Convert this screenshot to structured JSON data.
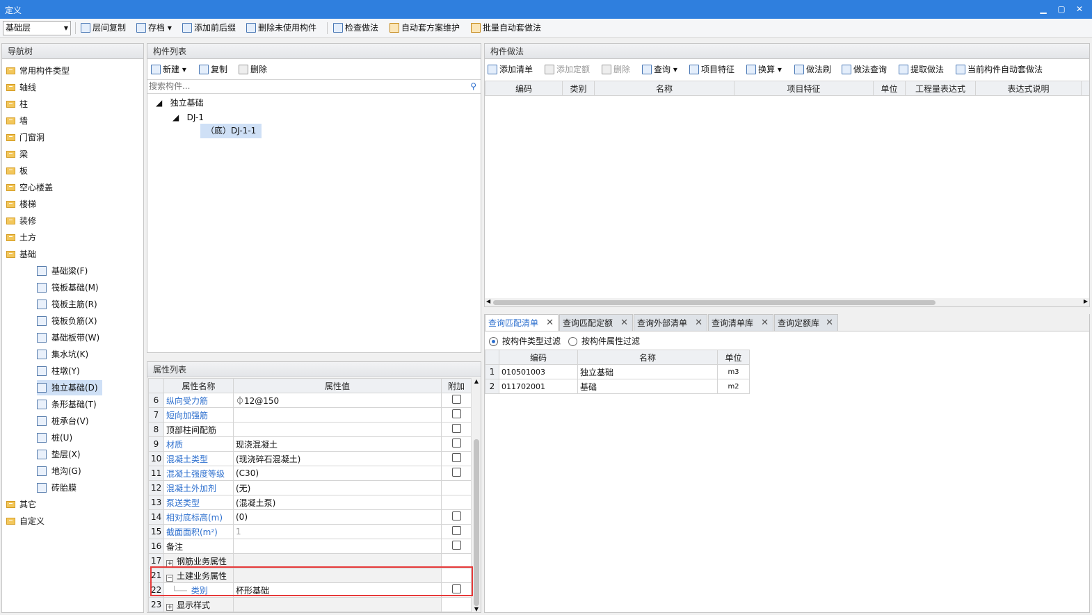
{
  "window": {
    "title": "定义"
  },
  "toolbar": {
    "floor_select": "基础层",
    "buttons": [
      "层间复制",
      "存档",
      "添加前后缀",
      "删除未使用构件",
      "检查做法",
      "自动套方案维护",
      "批量自动套做法"
    ]
  },
  "nav": {
    "title": "导航树",
    "top_items": [
      "常用构件类型",
      "轴线",
      "柱",
      "墙",
      "门窗洞",
      "梁",
      "板",
      "空心楼盖",
      "楼梯",
      "装修",
      "土方",
      "基础"
    ],
    "foundation_children": [
      "基础梁(F)",
      "筏板基础(M)",
      "筏板主筋(R)",
      "筏板负筋(X)",
      "基础板带(W)",
      "集水坑(K)",
      "柱墩(Y)",
      "独立基础(D)",
      "条形基础(T)",
      "桩承台(V)",
      "桩(U)",
      "垫层(X)",
      "地沟(G)",
      "砖胎膜"
    ],
    "bottom_items": [
      "其它",
      "自定义"
    ]
  },
  "component_list": {
    "title": "构件列表",
    "actions": [
      "新建",
      "复制",
      "删除"
    ],
    "search_placeholder": "搜索构件...",
    "tree": {
      "root": "独立基础",
      "child": "DJ-1",
      "leaf": "（底）DJ-1-1"
    }
  },
  "props": {
    "title": "属性列表",
    "headers": {
      "name": "属性名称",
      "value": "属性值",
      "extra": "附加"
    },
    "rows": [
      {
        "n": "6",
        "name": "纵向受力筋",
        "value": "⏀12@150",
        "link": true,
        "chk": true
      },
      {
        "n": "7",
        "name": "短向加强筋",
        "value": "",
        "link": true,
        "chk": true
      },
      {
        "n": "8",
        "name": "顶部柱间配筋",
        "value": "",
        "link": false,
        "chk": true
      },
      {
        "n": "9",
        "name": "材质",
        "value": "现浇混凝土",
        "link": true,
        "chk": true
      },
      {
        "n": "10",
        "name": "混凝土类型",
        "value": "(现浇碎石混凝土)",
        "link": true,
        "chk": true
      },
      {
        "n": "11",
        "name": "混凝土强度等级",
        "value": "(C30)",
        "link": true,
        "chk": true
      },
      {
        "n": "12",
        "name": "混凝土外加剂",
        "value": "(无)",
        "link": true,
        "chk": false
      },
      {
        "n": "13",
        "name": "泵送类型",
        "value": "(混凝土泵)",
        "link": true,
        "chk": false
      },
      {
        "n": "14",
        "name": "相对底标高(m)",
        "value": "(0)",
        "link": true,
        "chk": true
      },
      {
        "n": "15",
        "name": "截面面积(m²)",
        "value": "1",
        "link": true,
        "chk": true,
        "grey": true
      },
      {
        "n": "16",
        "name": "备注",
        "value": "",
        "link": false,
        "chk": true
      },
      {
        "n": "17",
        "name": "钢筋业务属性",
        "value": "",
        "link": false,
        "chk": false,
        "group": "+"
      },
      {
        "n": "21",
        "name": "土建业务属性",
        "value": "",
        "link": false,
        "chk": false,
        "group": "−"
      },
      {
        "n": "22",
        "name": "类别",
        "value": "杯形基础",
        "link": true,
        "chk": true,
        "indent": true
      },
      {
        "n": "23",
        "name": "显示样式",
        "value": "",
        "link": false,
        "chk": false,
        "group": "+"
      }
    ]
  },
  "method": {
    "title": "构件做法",
    "actions": [
      "添加清单",
      "添加定额",
      "删除",
      "查询",
      "项目特征",
      "换算",
      "做法刷",
      "做法查询",
      "提取做法",
      "当前构件自动套做法"
    ],
    "headers": [
      "编码",
      "类别",
      "名称",
      "项目特征",
      "单位",
      "工程量表达式",
      "表达式说明"
    ]
  },
  "query": {
    "tabs": [
      "查询匹配清单",
      "查询匹配定额",
      "查询外部清单",
      "查询清单库",
      "查询定额库"
    ],
    "filters": [
      "按构件类型过滤",
      "按构件属性过滤"
    ],
    "headers": [
      "编码",
      "名称",
      "单位"
    ],
    "rows": [
      {
        "n": "1",
        "code": "010501003",
        "name": "独立基础",
        "unit": "m3"
      },
      {
        "n": "2",
        "code": "011702001",
        "name": "基础",
        "unit": "m2"
      }
    ]
  }
}
